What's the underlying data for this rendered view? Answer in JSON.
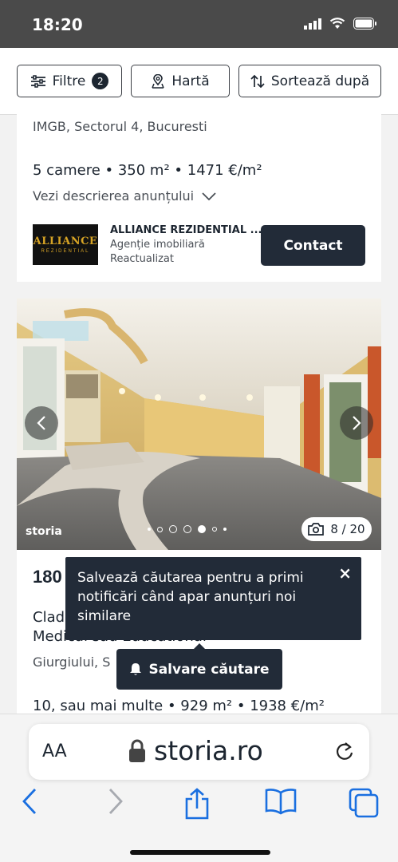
{
  "status": {
    "time": "18:20"
  },
  "toolbar": {
    "filters_label": "Filtre",
    "filters_count": "2",
    "map_label": "Hartă",
    "sort_label": "Sortează după"
  },
  "listing1": {
    "location": "IMGB, Sectorul 4, Bucuresti",
    "specs": "5 camere • 350 m² • 1471 €/m²",
    "description_link": "Vezi descrierea anunțului",
    "agency_logo_text": "ALLIANCE",
    "agency_logo_sub": "REZIDENTIAL",
    "agency_name": "ALLIANCE REZIDENTIAL ...",
    "agency_type": "Agenție imobiliară",
    "agency_status": "Reactualizat",
    "contact_label": "Contact"
  },
  "listing2": {
    "watermark": "storia",
    "photo_counter": "8 / 20",
    "price_partial": "180",
    "title_line1": "Clad",
    "title_line2": "Medical sau Educational",
    "location_partial": "Giurgiului, S",
    "specs": "10, sau mai multe • 929 m² • 1938 €/m²"
  },
  "tooltip": {
    "text": "Salvează căutarea pentru a primi notificări când apar anunțuri noi similare",
    "close": "×"
  },
  "save_search": {
    "label": "Salvare căutare"
  },
  "browser": {
    "aa_label": "AA",
    "url": "storia.ro"
  }
}
